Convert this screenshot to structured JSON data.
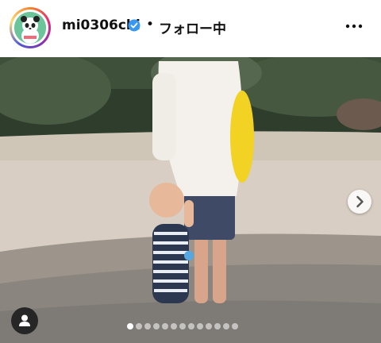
{
  "header": {
    "username": "mi0306chi",
    "separator": "•",
    "follow_status": "フォロー中",
    "verified_icon": "verified-badge-icon",
    "more_icon": "more-options-icon",
    "accent": "#3897f0"
  },
  "post": {
    "media_icon_next": "chevron-right-icon",
    "user_tag_icon": "person-icon",
    "carousel": {
      "count": 13,
      "active_index": 0
    }
  }
}
